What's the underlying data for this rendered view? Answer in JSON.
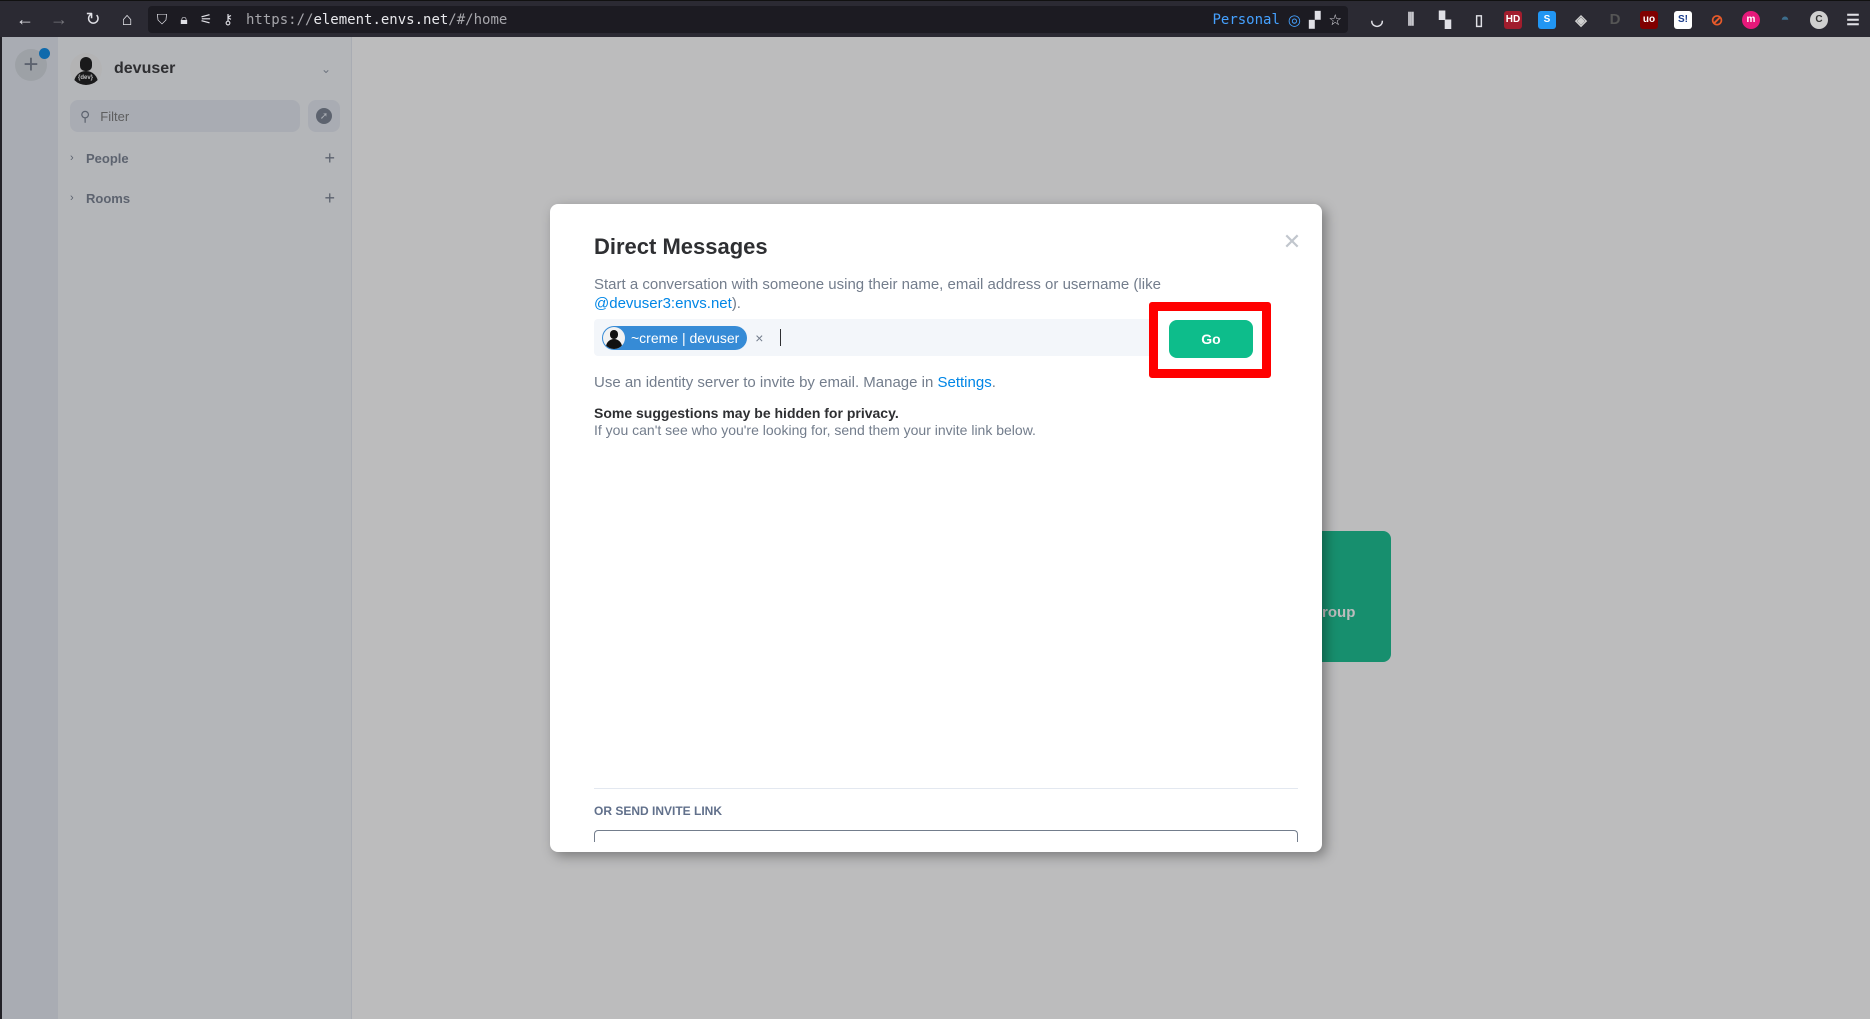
{
  "browser": {
    "url_scheme": "https://",
    "url_host": "element.envs.net",
    "url_path": "/#/home",
    "container_label": "Personal",
    "icons": [
      "back-icon",
      "forward-icon",
      "reload-icon",
      "home-icon",
      "shield-icon",
      "lock-icon",
      "permissions-icon",
      "key-icon"
    ]
  },
  "extensions": [
    {
      "name": "pocket-icon",
      "glyph": "◡",
      "bg": "transparent",
      "fg": "#e0e0e6"
    },
    {
      "name": "library-icon",
      "glyph": "⫼",
      "bg": "transparent",
      "fg": "#e0e0e6"
    },
    {
      "name": "add-tile-icon",
      "glyph": "▚",
      "bg": "transparent",
      "fg": "#e0e0e6"
    },
    {
      "name": "sidebar-icon",
      "glyph": "▯",
      "bg": "transparent",
      "fg": "#e0e0e6"
    },
    {
      "name": "hd-icon",
      "glyph": "HD",
      "bg": "#a11d2d",
      "fg": "#ffffff"
    },
    {
      "name": "s-extension-icon",
      "glyph": "S",
      "bg": "#2196f3",
      "fg": "#ffffff"
    },
    {
      "name": "badger-icon",
      "glyph": "◈",
      "bg": "transparent",
      "fg": "#d0d0d0"
    },
    {
      "name": "d-extension-icon",
      "glyph": "D",
      "bg": "transparent",
      "fg": "#555555"
    },
    {
      "name": "ublock-icon",
      "glyph": "uo",
      "bg": "#800000",
      "fg": "#ffffff"
    },
    {
      "name": "s-red-extension-icon",
      "glyph": "S!",
      "bg": "#ffffff",
      "fg": "#1a3c8c"
    },
    {
      "name": "no-cookie-icon",
      "glyph": "⊘",
      "bg": "transparent",
      "fg": "#e85a2a"
    },
    {
      "name": "m-extension-icon",
      "glyph": "m",
      "bg": "#e6197a",
      "fg": "#ffffff"
    },
    {
      "name": "spy-icon",
      "glyph": "◓",
      "bg": "transparent",
      "fg": "#3d6d8c"
    },
    {
      "name": "c-profile-icon",
      "glyph": "C",
      "bg": "#cfcfcf",
      "fg": "#333333"
    },
    {
      "name": "menu-icon",
      "glyph": "☰",
      "bg": "transparent",
      "fg": "#e0e0e6"
    }
  ],
  "sidebar": {
    "username": "devuser",
    "filter_placeholder": "Filter",
    "sections": [
      {
        "label": "People"
      },
      {
        "label": "Rooms"
      }
    ]
  },
  "home": {
    "card_text": "Create a Group Chat"
  },
  "dialog": {
    "title": "Direct Messages",
    "description_prefix": "Start a conversation with someone using their name, email address or username (like ",
    "description_link": "@devuser3:envs.net",
    "description_suffix": ").",
    "selected_pill": "~creme | devuser",
    "pill_remove": "×",
    "go_label": "Go",
    "identity_prefix": "Use an identity server to invite by email. Manage in ",
    "identity_link": "Settings",
    "identity_suffix": ".",
    "privacy_title": "Some suggestions may be hidden for privacy.",
    "privacy_sub": "If you can't see who you're looking for, send them your invite link below.",
    "invite_link_label": "OR SEND INVITE LINK",
    "close_glyph": "✕"
  },
  "colors": {
    "accent": "#0dbd8b",
    "link": "#0086e6",
    "pill": "#368bd6",
    "highlight": "#ff0000"
  }
}
